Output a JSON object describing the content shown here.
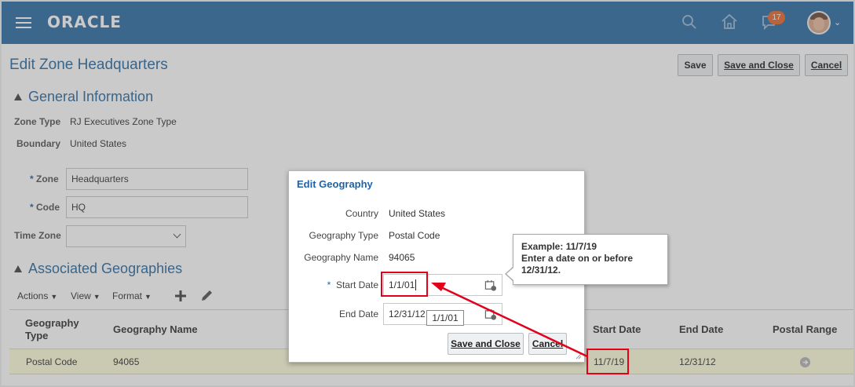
{
  "header": {
    "logo": "ORACLE",
    "notification_count": "17"
  },
  "page": {
    "title": "Edit Zone Headquarters",
    "save_label": "Save",
    "save_close_label": "Save and Close",
    "cancel_label": "Cancel"
  },
  "general": {
    "title": "General Information",
    "zone_type_label": "Zone Type",
    "zone_type_value": "RJ Executives Zone Type",
    "boundary_label": "Boundary",
    "boundary_value": "United States",
    "zone_label": "Zone",
    "zone_value": "Headquarters",
    "code_label": "Code",
    "code_value": "HQ",
    "time_zone_label": "Time Zone",
    "time_zone_value": "",
    "required_marker": "*"
  },
  "associated": {
    "title": "Associated Geographies",
    "toolbar": {
      "actions": "Actions",
      "view": "View",
      "format": "Format"
    },
    "columns": {
      "geo_type_line1": "Geography",
      "geo_type_line2": "Type",
      "geo_name": "Geography Name",
      "start_date": "Start Date",
      "end_date": "End Date",
      "postal_range": "Postal Range"
    },
    "rows": [
      {
        "geo_type": "Postal Code",
        "geo_name": "94065",
        "start_date": "11/7/19",
        "end_date": "12/31/12"
      }
    ]
  },
  "dialog": {
    "title": "Edit Geography",
    "country_label": "Country",
    "country_value": "United States",
    "geo_type_label": "Geography Type",
    "geo_type_value": "Postal Code",
    "geo_name_label": "Geography Name",
    "geo_name_value": "94065",
    "start_date_label": "Start Date",
    "start_date_value": "1/1/01",
    "end_date_label": "End Date",
    "end_date_value": "12/31/12",
    "save_close_label": "Save and Close",
    "cancel_label": "Cancel",
    "required_marker": "*"
  },
  "tooltip": {
    "line1": "Example: 11/7/19",
    "line2": "Enter a date on or before",
    "line3": "12/31/12."
  },
  "mini_tip": "1/1/01",
  "colors": {
    "header_bg": "#2e6ea6",
    "title_blue": "#2a6aa3",
    "highlight_red": "#e3001b",
    "row_highlight": "#ffffde"
  }
}
